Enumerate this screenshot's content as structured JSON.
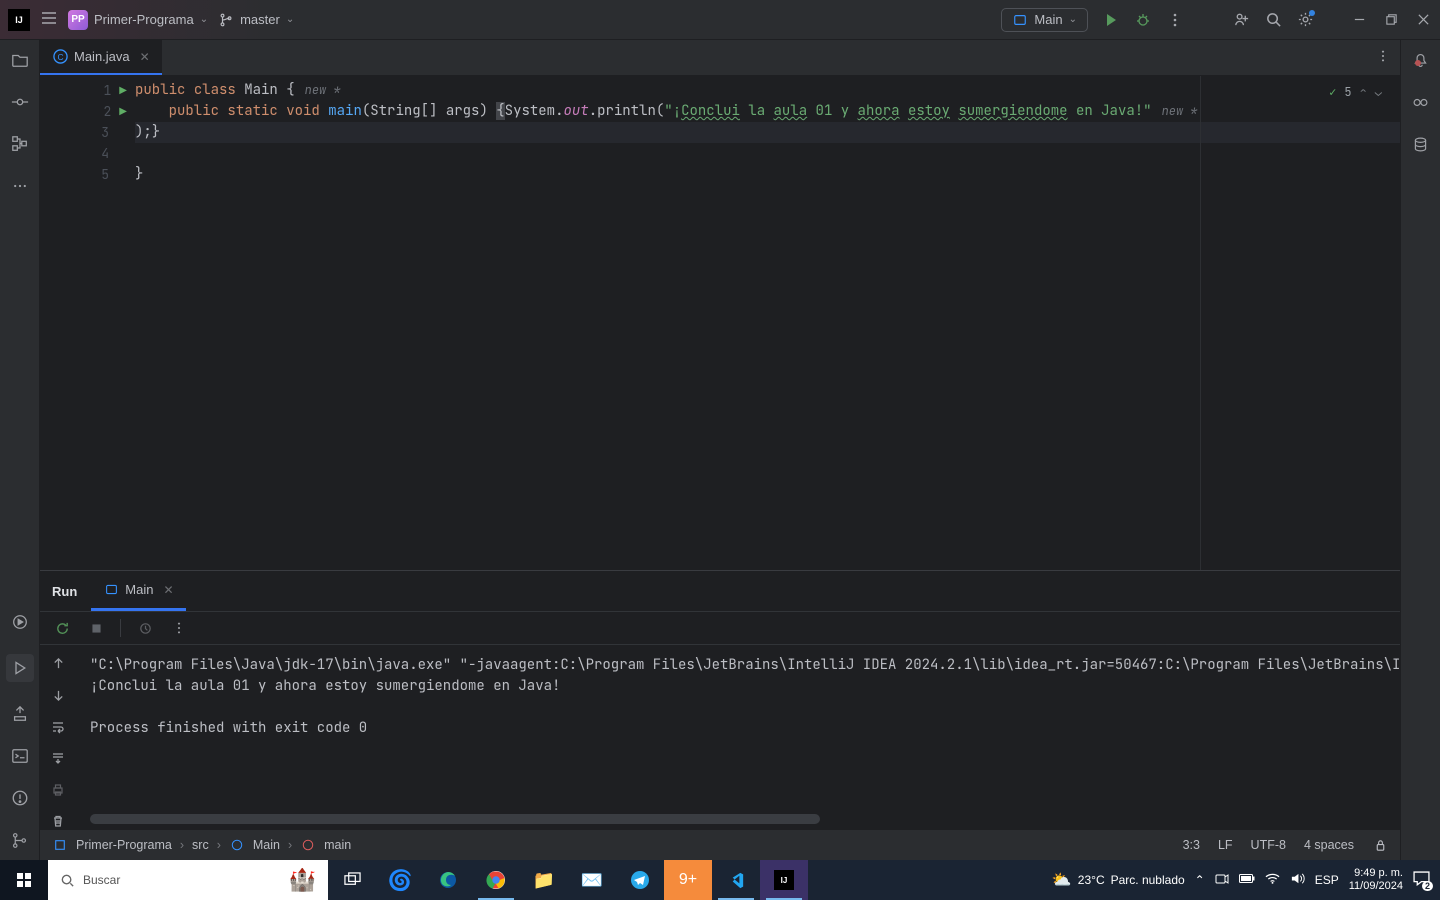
{
  "titlebar": {
    "project_badge": "PP",
    "project_name": "Primer-Programa",
    "branch": "master",
    "run_config": "Main"
  },
  "tabs": {
    "file": "Main.java"
  },
  "inspection": {
    "count": "5"
  },
  "code": {
    "l1_kw1": "public",
    "l1_kw2": "class",
    "l1_cls": "Main",
    "l1_brace": " {",
    "l1_inlay": "new *",
    "l2_indent": "    ",
    "l2_kw1": "public",
    "l2_kw2": "static",
    "l2_kw3": "void",
    "l2_fn": "main",
    "l2_args": "(String[] args) ",
    "l2_brace": "{",
    "l2_sys": "System.",
    "l2_out": "out",
    "l2_println": ".println(",
    "l2_q1": "\"¡",
    "l2_w1": "Conclui",
    "l2_w1s": " la ",
    "l2_w2": "aula",
    "l2_w2s": " 01 y ",
    "l2_w3": "ahora",
    "l2_w3s": " ",
    "l2_w4": "estoy",
    "l2_w4s": " ",
    "l2_w5": "sumergiendome",
    "l2_w5s": " en Java!",
    "l2_q2": "\"",
    "l2_inlay": "new *",
    "l3": ");}",
    "l5": "}"
  },
  "gutter": {
    "n1": "1",
    "n2": "2",
    "n3": "3",
    "n4": "4",
    "n5": "5"
  },
  "run": {
    "label": "Run",
    "tab": "Main",
    "out_cmd": "\"C:\\Program Files\\Java\\jdk-17\\bin\\java.exe\" \"-javaagent:C:\\Program Files\\JetBrains\\IntelliJ IDEA 2024.2.1\\lib\\idea_rt.jar=50467:C:\\Program Files\\JetBrains\\IntelliJ",
    "out_line": "¡Conclui la aula 01 y ahora estoy sumergiendome en Java!",
    "out_exit": "Process finished with exit code 0"
  },
  "breadcrumb": {
    "p1": "Primer-Programa",
    "p2": "src",
    "p3": "Main",
    "p4": "main"
  },
  "status": {
    "pos": "3:3",
    "eol": "LF",
    "enc": "UTF-8",
    "indent": "4 spaces"
  },
  "taskbar": {
    "search_placeholder": "Buscar",
    "weather_temp": "23°C",
    "weather_desc": "Parc. nublado",
    "lang": "ESP",
    "time": "9:49 p. m.",
    "date": "11/09/2024",
    "notif": "2"
  }
}
